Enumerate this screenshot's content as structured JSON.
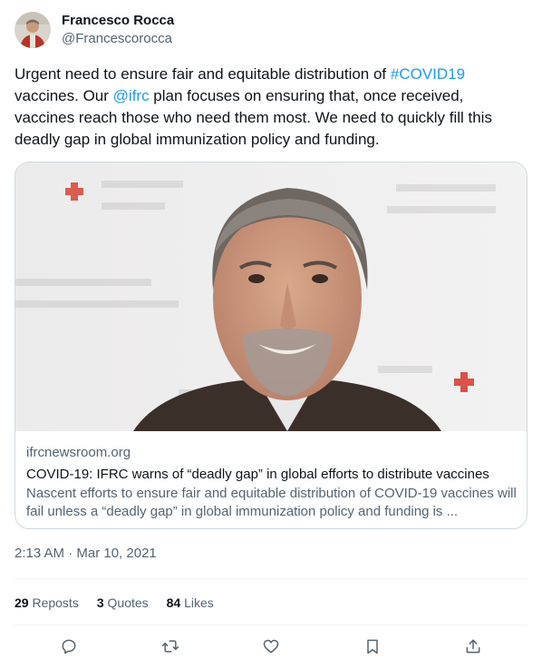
{
  "author": {
    "name": "Francesco Rocca",
    "handle": "@Francescorocca"
  },
  "tweet": {
    "text_1": "Urgent need to ensure fair and equitable distribution of ",
    "hashtag": "#COVID19",
    "text_2": " vaccines. Our ",
    "mention": "@ifrc",
    "text_3": " plan focuses on ensuring that, once received, vaccines reach those who need them most. We need to quickly fill this deadly gap in global immunization policy and funding."
  },
  "card": {
    "domain": "ifrcnewsroom.org",
    "title": "COVID-19: IFRC warns of “deadly gap” in global efforts to distribute vaccines",
    "description": "Nascent efforts to ensure fair and equitable distribution of COVID-19 vaccines will fail unless a “deadly gap” in global immunization policy and funding is ..."
  },
  "timestamp": "2:13 AM · Mar 10, 2021",
  "stats": {
    "reposts_count": "29",
    "reposts_label": " Reposts",
    "quotes_count": "3",
    "quotes_label": " Quotes",
    "likes_count": "84",
    "likes_label": " Likes"
  },
  "actions": [
    "reply-icon",
    "repost-icon",
    "like-icon",
    "bookmark-icon",
    "share-icon"
  ],
  "colors": {
    "link": "#1d9bf0",
    "secondary_text": "#536471",
    "primary_text": "#0f1419",
    "border": "#cfd9de",
    "red_cross": "#d52b1e"
  }
}
